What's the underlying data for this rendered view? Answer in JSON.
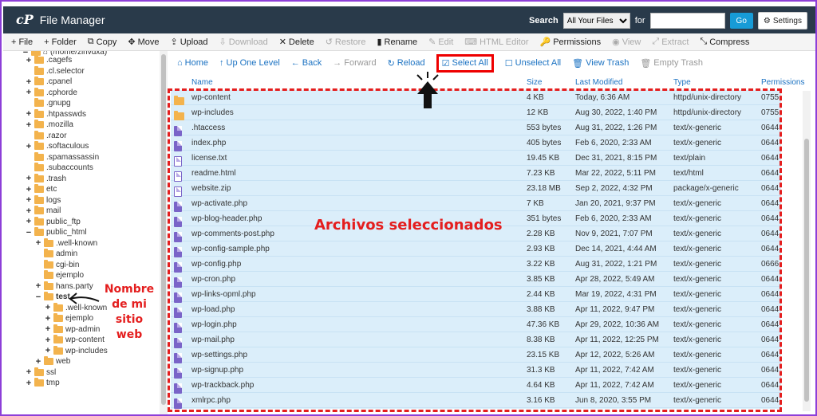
{
  "app": {
    "title": "File Manager",
    "logo": "cP"
  },
  "search": {
    "label": "Search",
    "scope": "All Your Files",
    "for_label": "for",
    "go": "Go",
    "settings": "Settings"
  },
  "toolbar": [
    "File",
    "Folder",
    "Copy",
    "Move",
    "Upload",
    "Download",
    "Delete",
    "Restore",
    "Rename",
    "Edit",
    "HTML Editor",
    "Permissions",
    "View",
    "Extract",
    "Compress"
  ],
  "toolbar_disabled": [
    "Download",
    "Restore",
    "Edit",
    "HTML Editor",
    "View",
    "Extract"
  ],
  "sidebar": {
    "root_partial": "(/home/zihvdxa)",
    "items": [
      {
        "label": ".cagefs",
        "toggle": "+"
      },
      {
        "label": ".cl.selector",
        "toggle": ""
      },
      {
        "label": ".cpanel",
        "toggle": "+"
      },
      {
        "label": ".cphorde",
        "toggle": "+"
      },
      {
        "label": ".gnupg",
        "toggle": ""
      },
      {
        "label": ".htpasswds",
        "toggle": "+"
      },
      {
        "label": ".mozilla",
        "toggle": "+"
      },
      {
        "label": ".razor",
        "toggle": ""
      },
      {
        "label": ".softaculous",
        "toggle": "+"
      },
      {
        "label": ".spamassassin",
        "toggle": ""
      },
      {
        "label": ".subaccounts",
        "toggle": ""
      },
      {
        "label": ".trash",
        "toggle": "+"
      },
      {
        "label": "etc",
        "toggle": "+"
      },
      {
        "label": "logs",
        "toggle": "+"
      },
      {
        "label": "mail",
        "toggle": "+"
      },
      {
        "label": "public_ftp",
        "toggle": "+"
      },
      {
        "label": "public_html",
        "toggle": "−"
      },
      {
        "label": ".well-known",
        "toggle": "+"
      },
      {
        "label": "admin",
        "toggle": ""
      },
      {
        "label": "cgi-bin",
        "toggle": ""
      },
      {
        "label": "ejemplo",
        "toggle": ""
      },
      {
        "label": "hans.party",
        "toggle": "+"
      },
      {
        "label": "test",
        "toggle": "−"
      },
      {
        "label": ".well-known",
        "toggle": "+"
      },
      {
        "label": "ejemplo",
        "toggle": "+"
      },
      {
        "label": "wp-admin",
        "toggle": "+"
      },
      {
        "label": "wp-content",
        "toggle": "+"
      },
      {
        "label": "wp-includes",
        "toggle": "+"
      },
      {
        "label": "web",
        "toggle": "+"
      },
      {
        "label": "ssl",
        "toggle": "+"
      },
      {
        "label": "tmp",
        "toggle": "+"
      }
    ]
  },
  "content_toolbar": {
    "home": "Home",
    "up": "Up One Level",
    "back": "Back",
    "forward": "Forward",
    "reload": "Reload",
    "select_all": "Select All",
    "unselect_all": "Unselect All",
    "view_trash": "View Trash",
    "empty_trash": "Empty Trash"
  },
  "columns": {
    "name": "Name",
    "size": "Size",
    "modified": "Last Modified",
    "type": "Type",
    "perms": "Permissions"
  },
  "files": [
    {
      "name": "wp-content",
      "size": "4 KB",
      "modified": "Today, 6:36 AM",
      "type": "httpd/unix-directory",
      "perms": "0755",
      "icon": "folder"
    },
    {
      "name": "wp-includes",
      "size": "12 KB",
      "modified": "Aug 30, 2022, 1:40 PM",
      "type": "httpd/unix-directory",
      "perms": "0755",
      "icon": "folder"
    },
    {
      "name": ".htaccess",
      "size": "553 bytes",
      "modified": "Aug 31, 2022, 1:26 PM",
      "type": "text/x-generic",
      "perms": "0644",
      "icon": "file"
    },
    {
      "name": "index.php",
      "size": "405 bytes",
      "modified": "Feb 6, 2020, 2:33 AM",
      "type": "text/x-generic",
      "perms": "0644",
      "icon": "file"
    },
    {
      "name": "license.txt",
      "size": "19.45 KB",
      "modified": "Dec 31, 2021, 8:15 PM",
      "type": "text/plain",
      "perms": "0644",
      "icon": "file-light"
    },
    {
      "name": "readme.html",
      "size": "7.23 KB",
      "modified": "Mar 22, 2022, 5:11 PM",
      "type": "text/html",
      "perms": "0644",
      "icon": "file-light"
    },
    {
      "name": "website.zip",
      "size": "23.18 MB",
      "modified": "Sep 2, 2022, 4:32 PM",
      "type": "package/x-generic",
      "perms": "0644",
      "icon": "file-light"
    },
    {
      "name": "wp-activate.php",
      "size": "7 KB",
      "modified": "Jan 20, 2021, 9:37 PM",
      "type": "text/x-generic",
      "perms": "0644",
      "icon": "file"
    },
    {
      "name": "wp-blog-header.php",
      "size": "351 bytes",
      "modified": "Feb 6, 2020, 2:33 AM",
      "type": "text/x-generic",
      "perms": "0644",
      "icon": "file"
    },
    {
      "name": "wp-comments-post.php",
      "size": "2.28 KB",
      "modified": "Nov 9, 2021, 7:07 PM",
      "type": "text/x-generic",
      "perms": "0644",
      "icon": "file"
    },
    {
      "name": "wp-config-sample.php",
      "size": "2.93 KB",
      "modified": "Dec 14, 2021, 4:44 AM",
      "type": "text/x-generic",
      "perms": "0644",
      "icon": "file"
    },
    {
      "name": "wp-config.php",
      "size": "3.22 KB",
      "modified": "Aug 31, 2022, 1:21 PM",
      "type": "text/x-generic",
      "perms": "0666",
      "icon": "file"
    },
    {
      "name": "wp-cron.php",
      "size": "3.85 KB",
      "modified": "Apr 28, 2022, 5:49 AM",
      "type": "text/x-generic",
      "perms": "0644",
      "icon": "file"
    },
    {
      "name": "wp-links-opml.php",
      "size": "2.44 KB",
      "modified": "Mar 19, 2022, 4:31 PM",
      "type": "text/x-generic",
      "perms": "0644",
      "icon": "file"
    },
    {
      "name": "wp-load.php",
      "size": "3.88 KB",
      "modified": "Apr 11, 2022, 9:47 PM",
      "type": "text/x-generic",
      "perms": "0644",
      "icon": "file"
    },
    {
      "name": "wp-login.php",
      "size": "47.36 KB",
      "modified": "Apr 29, 2022, 10:36 AM",
      "type": "text/x-generic",
      "perms": "0644",
      "icon": "file"
    },
    {
      "name": "wp-mail.php",
      "size": "8.38 KB",
      "modified": "Apr 11, 2022, 12:25 PM",
      "type": "text/x-generic",
      "perms": "0644",
      "icon": "file"
    },
    {
      "name": "wp-settings.php",
      "size": "23.15 KB",
      "modified": "Apr 12, 2022, 5:26 AM",
      "type": "text/x-generic",
      "perms": "0644",
      "icon": "file"
    },
    {
      "name": "wp-signup.php",
      "size": "31.3 KB",
      "modified": "Apr 11, 2022, 7:42 AM",
      "type": "text/x-generic",
      "perms": "0644",
      "icon": "file"
    },
    {
      "name": "wp-trackback.php",
      "size": "4.64 KB",
      "modified": "Apr 11, 2022, 7:42 AM",
      "type": "text/x-generic",
      "perms": "0644",
      "icon": "file"
    },
    {
      "name": "xmlrpc.php",
      "size": "3.16 KB",
      "modified": "Jun 8, 2020, 3:55 PM",
      "type": "text/x-generic",
      "perms": "0644",
      "icon": "file"
    }
  ],
  "annotations": {
    "selected": "Archivos seleccionados",
    "site_lines": [
      "Nombre",
      "de mi",
      "sitio",
      "web"
    ]
  },
  "colors": {
    "accent": "#e41e1e",
    "topbar": "#293a4a",
    "selection": "#dbeefa",
    "link": "#1b72c2",
    "border": "#8d3fd8"
  }
}
